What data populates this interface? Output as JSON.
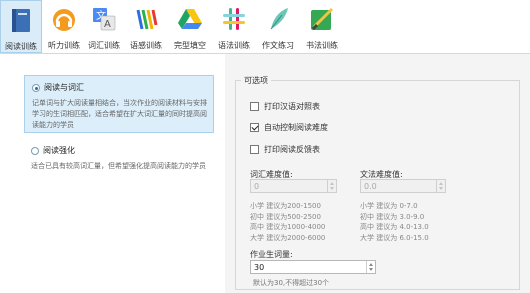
{
  "toolbar": {
    "items": [
      {
        "label": "阅读训练",
        "icon": "book-icon",
        "active": true
      },
      {
        "label": "听力训练",
        "icon": "headphones-icon",
        "active": false
      },
      {
        "label": "词汇训练",
        "icon": "translate-icon",
        "active": false
      },
      {
        "label": "语感训练",
        "icon": "waves-icon",
        "active": false
      },
      {
        "label": "完型填空",
        "icon": "drive-icon",
        "active": false
      },
      {
        "label": "语法训练",
        "icon": "grid-icon",
        "active": false
      },
      {
        "label": "作文练习",
        "icon": "quill-icon",
        "active": false
      },
      {
        "label": "书法训练",
        "icon": "brush-icon",
        "active": false
      }
    ]
  },
  "modes": [
    {
      "title": "阅读与词汇",
      "desc": "记单词与扩大阅读量相结合，当次作业的阅读材料与安排学习的生词相匹配，适合希望在扩大词汇量的同时提高阅读能力的学员",
      "selected": true
    },
    {
      "title": "阅读强化",
      "desc": "适合已具有较高词汇量，但希望强化提高阅读能力的学员",
      "selected": false
    }
  ],
  "options": {
    "group_title": "可选项",
    "checkboxes": [
      {
        "label": "打印汉语对照表",
        "checked": false
      },
      {
        "label": "自动控制阅读难度",
        "checked": true
      },
      {
        "label": "打印阅读反馈表",
        "checked": false
      }
    ],
    "vocab": {
      "label": "词汇难度值:",
      "value": "0",
      "suggestions": [
        "小学 建议为200-1500",
        "初中 建议为500-2500",
        "高中 建议为1000-4000",
        "大学 建议为2000-6000"
      ]
    },
    "text": {
      "label": "文法难度值:",
      "value": "0.0",
      "suggestions": [
        "小学 建议为 0-7.0",
        "初中 建议为 3.0-9.0",
        "高中 建议为 4.0-13.0",
        "大学 建议为 6.0-15.0"
      ]
    },
    "homework": {
      "label": "作业生词量:",
      "value": "30",
      "hint": "默认为30,不得超过30个"
    }
  },
  "colors": {
    "active_bg": "#d9ecf8",
    "selected_bg": "#dceefa",
    "panel_bg": "#f4f4f4"
  }
}
